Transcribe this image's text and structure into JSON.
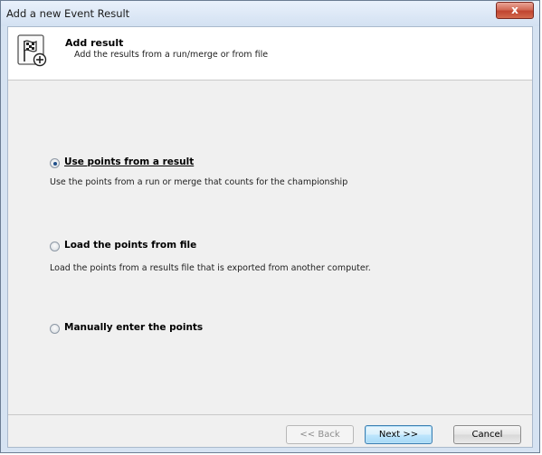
{
  "window": {
    "title": "Add a new Event Result",
    "close_glyph": "x"
  },
  "header": {
    "title": "Add result",
    "subtitle": "Add the results from a run/merge or from file",
    "icon": "checkered-flag-add-icon"
  },
  "options": [
    {
      "label": "Use points from a result",
      "description": "Use the points from a run or merge that counts for the championship",
      "selected": true
    },
    {
      "label": "Load the points from file",
      "description": "Load the points from a results file that is exported from another computer.",
      "selected": false
    },
    {
      "label": "Manually enter the points",
      "description": "",
      "selected": false
    }
  ],
  "buttons": {
    "back": "<< Back",
    "next": "Next >>",
    "cancel": "Cancel"
  }
}
